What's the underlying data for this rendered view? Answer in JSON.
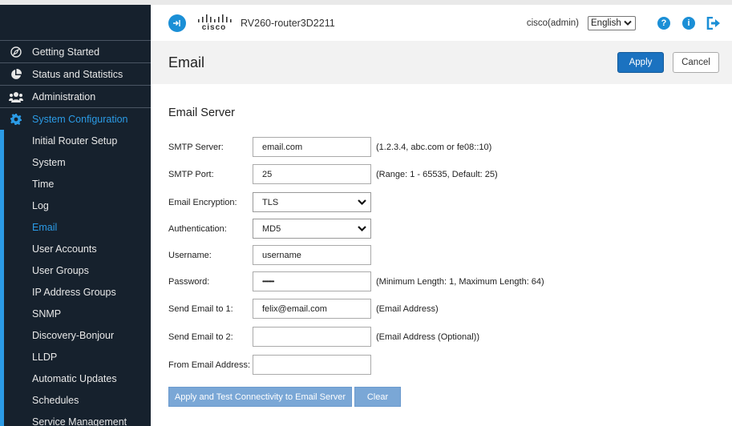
{
  "header": {
    "device_name": "RV260-router3D2211",
    "brand": "cisco",
    "user": "cisco(admin)",
    "language": "English",
    "help_icon": "question-icon",
    "info_icon": "info-icon",
    "logout_icon": "logout-icon",
    "accent_color": "#1b8fd6"
  },
  "sidebar": {
    "top_items": [
      {
        "label": "Getting Started",
        "icon": "compass-icon"
      },
      {
        "label": "Status and Statistics",
        "icon": "pie-chart-icon"
      },
      {
        "label": "Administration",
        "icon": "users-icon"
      },
      {
        "label": "System Configuration",
        "icon": "gear-icon",
        "active": true
      }
    ],
    "sub_items": [
      {
        "label": "Initial Router Setup"
      },
      {
        "label": "System"
      },
      {
        "label": "Time"
      },
      {
        "label": "Log"
      },
      {
        "label": "Email",
        "active": true
      },
      {
        "label": "User Accounts"
      },
      {
        "label": "User Groups"
      },
      {
        "label": "IP Address Groups"
      },
      {
        "label": "SNMP"
      },
      {
        "label": "Discovery-Bonjour"
      },
      {
        "label": "LLDP"
      },
      {
        "label": "Automatic Updates"
      },
      {
        "label": "Schedules"
      },
      {
        "label": "Service Management"
      }
    ]
  },
  "page": {
    "title": "Email",
    "apply_label": "Apply",
    "cancel_label": "Cancel"
  },
  "form": {
    "section_title": "Email Server",
    "smtp_server": {
      "label": "SMTP Server:",
      "value": "email.com",
      "hint": "(1.2.3.4, abc.com or fe08::10)"
    },
    "smtp_port": {
      "label": "SMTP Port:",
      "value": "25",
      "hint": "(Range: 1 - 65535, Default: 25)"
    },
    "encryption": {
      "label": "Email Encryption:",
      "value": "TLS"
    },
    "authentication": {
      "label": "Authentication:",
      "value": "MD5"
    },
    "username": {
      "label": "Username:",
      "value": "username"
    },
    "password": {
      "label": "Password:",
      "value": "••••••••",
      "hint": "(Minimum Length: 1, Maximum Length: 64)"
    },
    "send_to_1": {
      "label": "Send Email to 1:",
      "value": "felix@email.com",
      "hint": "(Email Address)"
    },
    "send_to_2": {
      "label": "Send Email to 2:",
      "value": "",
      "hint": "(Email Address (Optional))"
    },
    "from_address": {
      "label": "From Email Address:",
      "value": ""
    },
    "test_button_label": "Apply and Test Connectivity to Email Server",
    "clear_button_label": "Clear"
  }
}
